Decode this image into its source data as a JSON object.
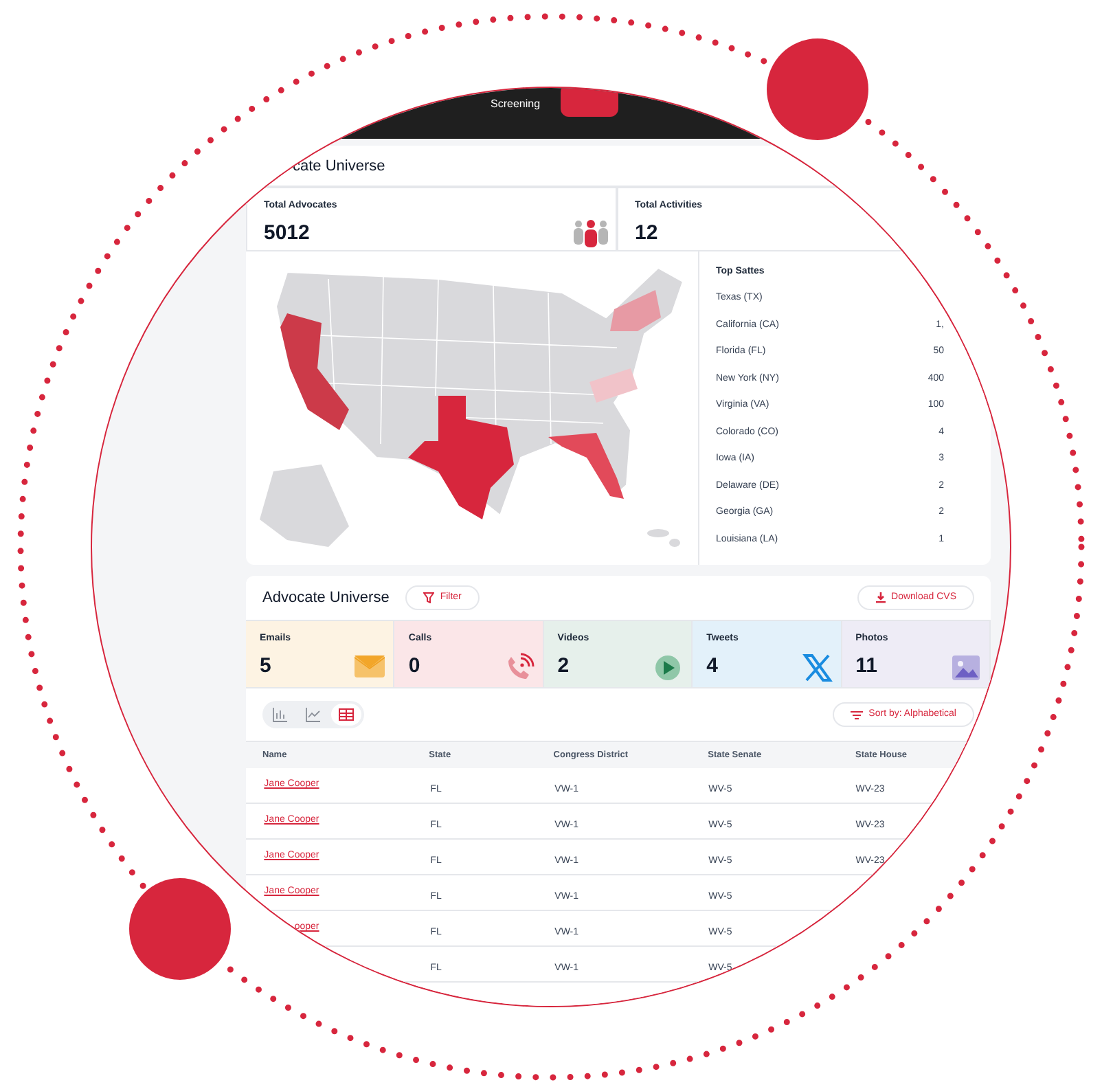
{
  "nav": {
    "tab_label": "Screening",
    "active_pill": true
  },
  "page_title": "cate Universe",
  "stats": [
    {
      "label": "Total Advocates",
      "value": "5012",
      "kind": "advocates"
    },
    {
      "label": "Total Activities",
      "value": "12",
      "kind": "activities"
    }
  ],
  "top_states": {
    "title": "Top Sattes",
    "items": [
      {
        "name": "Texas (TX)"
      },
      {
        "name": "California (CA)",
        "value": "1,"
      },
      {
        "name": "Florida (FL)",
        "value": "50"
      },
      {
        "name": "New York (NY)",
        "value": "400"
      },
      {
        "name": "Virginia (VA)",
        "value": "100"
      },
      {
        "name": "Colorado (CO)",
        "value": "4"
      },
      {
        "name": "Iowa (IA)",
        "value": "3"
      },
      {
        "name": "Delaware (DE)",
        "value": "2"
      },
      {
        "name": "Georgia (GA)",
        "value": "2"
      },
      {
        "name": "Louisiana (LA)",
        "value": "1"
      }
    ]
  },
  "universe": {
    "title": "Advocate Universe",
    "filter_label": "Filter",
    "download_label": "Download CVS",
    "tiles": [
      {
        "kind": "emails",
        "label": "Emails",
        "value": "5"
      },
      {
        "kind": "calls",
        "label": "Calls",
        "value": "0"
      },
      {
        "kind": "videos",
        "label": "Videos",
        "value": "2"
      },
      {
        "kind": "tweets",
        "label": "Tweets",
        "value": "4"
      },
      {
        "kind": "photos",
        "label": "Photos",
        "value": "11"
      }
    ],
    "views": [
      {
        "kind": "bar",
        "selected": false
      },
      {
        "kind": "line",
        "selected": false
      },
      {
        "kind": "table",
        "selected": true
      }
    ],
    "sort_label": "Sort by: Alphabetical"
  },
  "table": {
    "columns": [
      "Name",
      "State",
      "Congress District",
      "State Senate",
      "State House"
    ],
    "rows": [
      {
        "name": "Jane Cooper",
        "state": "FL",
        "district": "VW-1",
        "senate": "WV-5",
        "house": "WV-23"
      },
      {
        "name": "Jane Cooper",
        "state": "FL",
        "district": "VW-1",
        "senate": "WV-5",
        "house": "WV-23"
      },
      {
        "name": "Jane Cooper",
        "state": "FL",
        "district": "VW-1",
        "senate": "WV-5",
        "house": "WV-23"
      },
      {
        "name": "Jane Cooper",
        "state": "FL",
        "district": "VW-1",
        "senate": "WV-5"
      },
      {
        "name": "ooper",
        "state": "FL",
        "district": "VW-1",
        "senate": "WV-5"
      },
      {
        "state": "FL",
        "district": "VW-1",
        "senate": "WV-5"
      }
    ]
  }
}
